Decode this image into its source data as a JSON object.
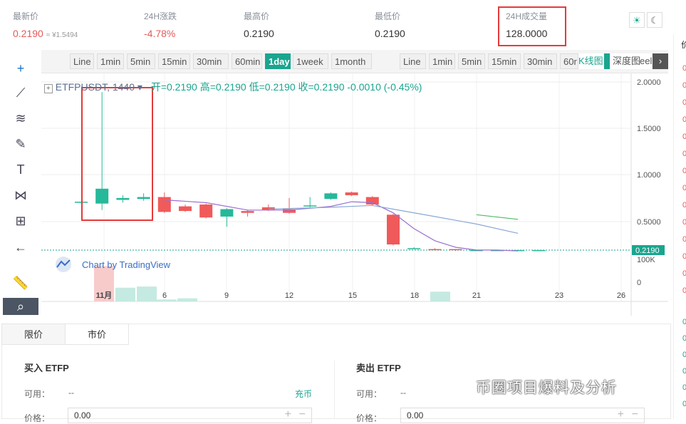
{
  "stats": {
    "latest": {
      "label": "最新价",
      "value": "0.2190",
      "approx": "≈ ¥1.5494"
    },
    "change": {
      "label": "24H涨跌",
      "value": "-4.78%"
    },
    "high": {
      "label": "最高价",
      "value": "0.2190"
    },
    "low": {
      "label": "最低价",
      "value": "0.2190"
    },
    "volume": {
      "label": "24H成交量",
      "value": "128.0000"
    }
  },
  "toolbar": {
    "left": [
      "Line",
      "1min",
      "5min",
      "15min",
      "30min",
      "60min",
      "1day",
      "1week",
      "1month"
    ],
    "right": [
      "Line",
      "1min",
      "5min",
      "15min",
      "30min",
      "60r"
    ],
    "active": "1day",
    "kline": "K线图",
    "depth": "深度图",
    "right_extra": "eel"
  },
  "symbar": {
    "symbol": "ETFPUSDT",
    "interval": "1440",
    "open": "开=0.2190",
    "high": "高=0.2190",
    "low": "低=0.2190",
    "close": "收=0.2190",
    "change": "-0.0010 (-0.45%)"
  },
  "chart_data": {
    "type": "candlestick",
    "x_ticks": [
      "11月",
      "6",
      "9",
      "12",
      "15",
      "18",
      "21",
      "23",
      "26"
    ],
    "y_ticks": [
      "2.0000",
      "1.5000",
      "1.0000",
      "0.5000"
    ],
    "price_label": "0.2190",
    "volume_label": "100K",
    "volume_zero": "0",
    "brand": "Chart by TradingView",
    "candles": [
      {
        "o": 0.74,
        "c": 0.74,
        "h": 0.74,
        "l": 0.74
      },
      {
        "o": 0.72,
        "c": 0.88,
        "h": 1.92,
        "l": 0.65
      },
      {
        "o": 0.76,
        "c": 0.78,
        "h": 0.81,
        "l": 0.73
      },
      {
        "o": 0.77,
        "c": 0.79,
        "h": 0.83,
        "l": 0.75
      },
      {
        "o": 0.79,
        "c": 0.63,
        "h": 0.84,
        "l": 0.62
      },
      {
        "o": 0.69,
        "c": 0.64,
        "h": 0.71,
        "l": 0.63
      },
      {
        "o": 0.71,
        "c": 0.57,
        "h": 0.72,
        "l": 0.56
      },
      {
        "o": 0.58,
        "c": 0.66,
        "h": 0.67,
        "l": 0.47
      },
      {
        "o": 0.64,
        "c": 0.62,
        "h": 0.65,
        "l": 0.58
      },
      {
        "o": 0.68,
        "c": 0.65,
        "h": 0.71,
        "l": 0.64
      },
      {
        "o": 0.66,
        "c": 0.62,
        "h": 0.78,
        "l": 0.61
      },
      {
        "o": 0.69,
        "c": 0.7,
        "h": 0.79,
        "l": 0.68
      },
      {
        "o": 0.77,
        "c": 0.83,
        "h": 0.84,
        "l": 0.76
      },
      {
        "o": 0.84,
        "c": 0.81,
        "h": 0.85,
        "l": 0.8
      },
      {
        "o": 0.79,
        "c": 0.71,
        "h": 0.8,
        "l": 0.7
      },
      {
        "o": 0.6,
        "c": 0.28,
        "h": 0.61,
        "l": 0.27
      },
      {
        "o": 0.24,
        "c": 0.24,
        "h": 0.25,
        "l": 0.23
      },
      {
        "o": 0.23,
        "c": 0.22,
        "h": 0.24,
        "l": 0.22
      },
      {
        "o": 0.23,
        "c": 0.22,
        "h": 0.23,
        "l": 0.21
      },
      {
        "o": 0.22,
        "c": 0.22,
        "h": 0.22,
        "l": 0.22
      },
      {
        "o": 0.22,
        "c": 0.22,
        "h": 0.22,
        "l": 0.22
      },
      {
        "o": 0.22,
        "c": 0.22,
        "h": 0.22,
        "l": 0.22
      },
      {
        "o": 0.22,
        "c": 0.22,
        "h": 0.22,
        "l": 0.22
      }
    ],
    "ma_purple": [
      [
        4,
        0.76
      ],
      [
        6,
        0.73
      ],
      [
        8,
        0.65
      ],
      [
        10,
        0.65
      ],
      [
        12,
        0.69
      ],
      [
        13,
        0.74
      ],
      [
        14,
        0.73
      ],
      [
        15,
        0.62
      ],
      [
        16,
        0.45
      ],
      [
        17,
        0.32
      ],
      [
        18,
        0.25
      ],
      [
        19,
        0.22
      ],
      [
        20,
        0.22
      ],
      [
        21,
        0.21
      ]
    ],
    "ma_blue": [
      [
        9,
        0.66
      ],
      [
        12,
        0.68
      ],
      [
        14,
        0.7
      ],
      [
        15,
        0.66
      ],
      [
        17,
        0.58
      ],
      [
        19,
        0.5
      ],
      [
        21,
        0.4
      ]
    ],
    "ma_green": [
      [
        19,
        0.6
      ],
      [
        21,
        0.55
      ]
    ],
    "colors": {
      "up": "#26b89a",
      "down": "#f05a5a",
      "accent": "#1aa58f",
      "red": "#e55a5a"
    }
  },
  "order": {
    "tabs": [
      "限价",
      "市价"
    ],
    "buy": {
      "title": "买入 ETFP",
      "avail_label": "可用：",
      "avail_value": "--",
      "deposit": "充币",
      "price_label": "价格：",
      "price_value": "0.00"
    },
    "sell": {
      "title": "卖出 ETFP",
      "avail_label": "可用：",
      "avail_value": "--",
      "price_label": "价格：",
      "price_value": "0.00"
    }
  },
  "rightpane": {
    "header": "价",
    "rows": [
      "0",
      "0",
      "0",
      "0",
      "0",
      "0",
      "0",
      "0",
      "0",
      "0",
      "0",
      "0",
      "0",
      "0"
    ],
    "rows_green": [
      "0",
      "0",
      "0",
      "0",
      "0",
      "0"
    ]
  },
  "watermark": "币圈项目爆料及分析"
}
